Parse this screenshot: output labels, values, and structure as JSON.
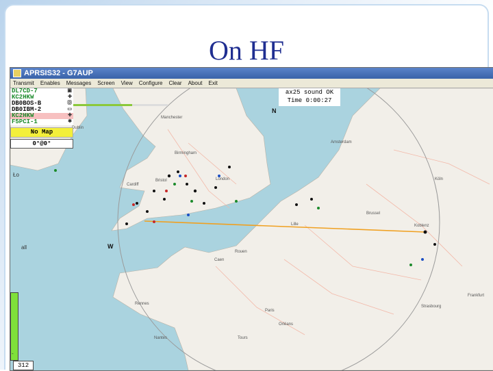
{
  "slide": {
    "title": "On HF"
  },
  "window": {
    "title": "APRSIS32 - G7AUP"
  },
  "menu": [
    "Transmit",
    "Enables",
    "Messages",
    "Screen",
    "View",
    "Configure",
    "Clear",
    "About",
    "Exit"
  ],
  "callsigns": [
    {
      "call": "DL7CD-7",
      "color": "#1b8a2b",
      "symbol": "▣"
    },
    {
      "call": "KC2HKW",
      "color": "#1b8a2b",
      "symbol": "✚"
    },
    {
      "call": "DB0BOS-B",
      "color": "#111111",
      "symbol": "Ⓓ"
    },
    {
      "call": "DB0IBM-2",
      "color": "#111111",
      "symbol": "▭"
    },
    {
      "call": "KC2HKW",
      "color": "#1b8a2b",
      "symbol": "✚"
    },
    {
      "call": "F5PCI-1",
      "color": "#1b8a2b",
      "symbol": "✱"
    }
  ],
  "status": {
    "mode": "ax25 sound OK",
    "time": "Time 0:00:27"
  },
  "nomap": "No Map",
  "coord": "0°@0°",
  "progress": 0.62,
  "count": "312",
  "compass": {
    "n": "N",
    "w": "W"
  },
  "side": {
    "left_tick": "Ło",
    "all_tick": "all",
    "bottom_tick": "-"
  },
  "map_labels": [
    {
      "id": "amsterdam",
      "text": "Amsterdam"
    },
    {
      "id": "london",
      "text": "London"
    },
    {
      "id": "paris",
      "text": "Paris"
    },
    {
      "id": "brussels",
      "text": "Brussel"
    },
    {
      "id": "koln",
      "text": "Köln"
    },
    {
      "id": "frankfurt",
      "text": "Frankfurt"
    },
    {
      "id": "rouen",
      "text": "Rouen"
    },
    {
      "id": "caen",
      "text": "Caen"
    },
    {
      "id": "lille",
      "text": "Lille"
    },
    {
      "id": "rennes",
      "text": "Rennes"
    },
    {
      "id": "nantes",
      "text": "Nantes"
    },
    {
      "id": "tours",
      "text": "Tours"
    },
    {
      "id": "orleans",
      "text": "Orléans"
    },
    {
      "id": "dublin",
      "text": "Dublin"
    },
    {
      "id": "manchester",
      "text": "Manchester"
    },
    {
      "id": "birmingham",
      "text": "Birmingham"
    },
    {
      "id": "bristol",
      "text": "Bristol"
    },
    {
      "id": "cardiff",
      "text": "Cardiff"
    },
    {
      "id": "strasbourg",
      "text": "Strasbourg"
    },
    {
      "id": "koblenz",
      "text": "Koblenz"
    }
  ],
  "colors": {
    "sea": "#aad3df",
    "land": "#f2efe9",
    "path": "#f0a020",
    "ring": "#9a9a9a"
  }
}
